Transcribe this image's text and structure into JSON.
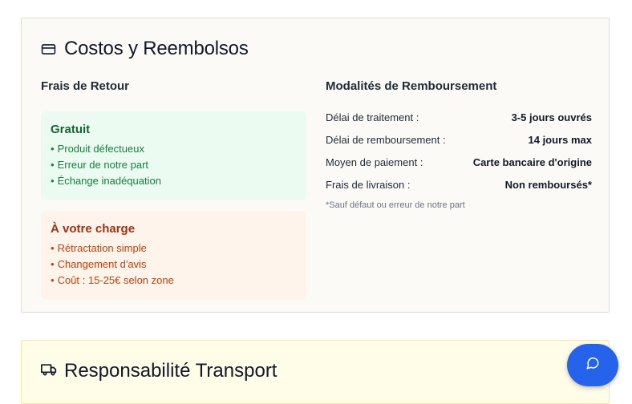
{
  "costs": {
    "title": "Costos y Reembolsos",
    "icon": "credit-card-icon",
    "return_fees": {
      "heading": "Frais de Retour",
      "free": {
        "title": "Gratuit",
        "items": [
          "Produit défectueux",
          "Erreur de notre part",
          "Échange inadéquation"
        ]
      },
      "paid": {
        "title": "À votre charge",
        "items": [
          "Rétractation simple",
          "Changement d'avis",
          "Coût : 15-25€ selon zone"
        ]
      }
    },
    "refund": {
      "heading": "Modalités de Remboursement",
      "rows": [
        {
          "label": "Délai de traitement :",
          "value": "3-5 jours ouvrés"
        },
        {
          "label": "Délai de remboursement :",
          "value": "14 jours max"
        },
        {
          "label": "Moyen de paiement :",
          "value": "Carte bancaire d'origine"
        },
        {
          "label": "Frais de livraison :",
          "value": "Non remboursés*"
        }
      ],
      "footnote": "*Sauf défaut ou erreur de notre part"
    }
  },
  "transport": {
    "title": "Responsabilité Transport",
    "icon": "truck-icon"
  },
  "chat": {
    "icon": "chat-bubble-icon",
    "color": "#2563eb"
  },
  "colors": {
    "free_bg": "#ecfbf1",
    "free_text": "#15803d",
    "paid_bg": "#fff4ec",
    "paid_text": "#c2410c"
  }
}
